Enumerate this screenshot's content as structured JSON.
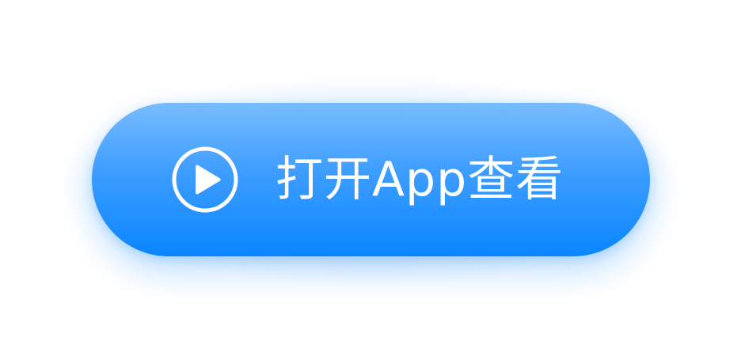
{
  "button": {
    "label": "打开App查看",
    "icon": "play-circle-icon",
    "gradient_top": "#78bcff",
    "gradient_bottom": "#0a85ff",
    "text_color": "#ffffff"
  }
}
